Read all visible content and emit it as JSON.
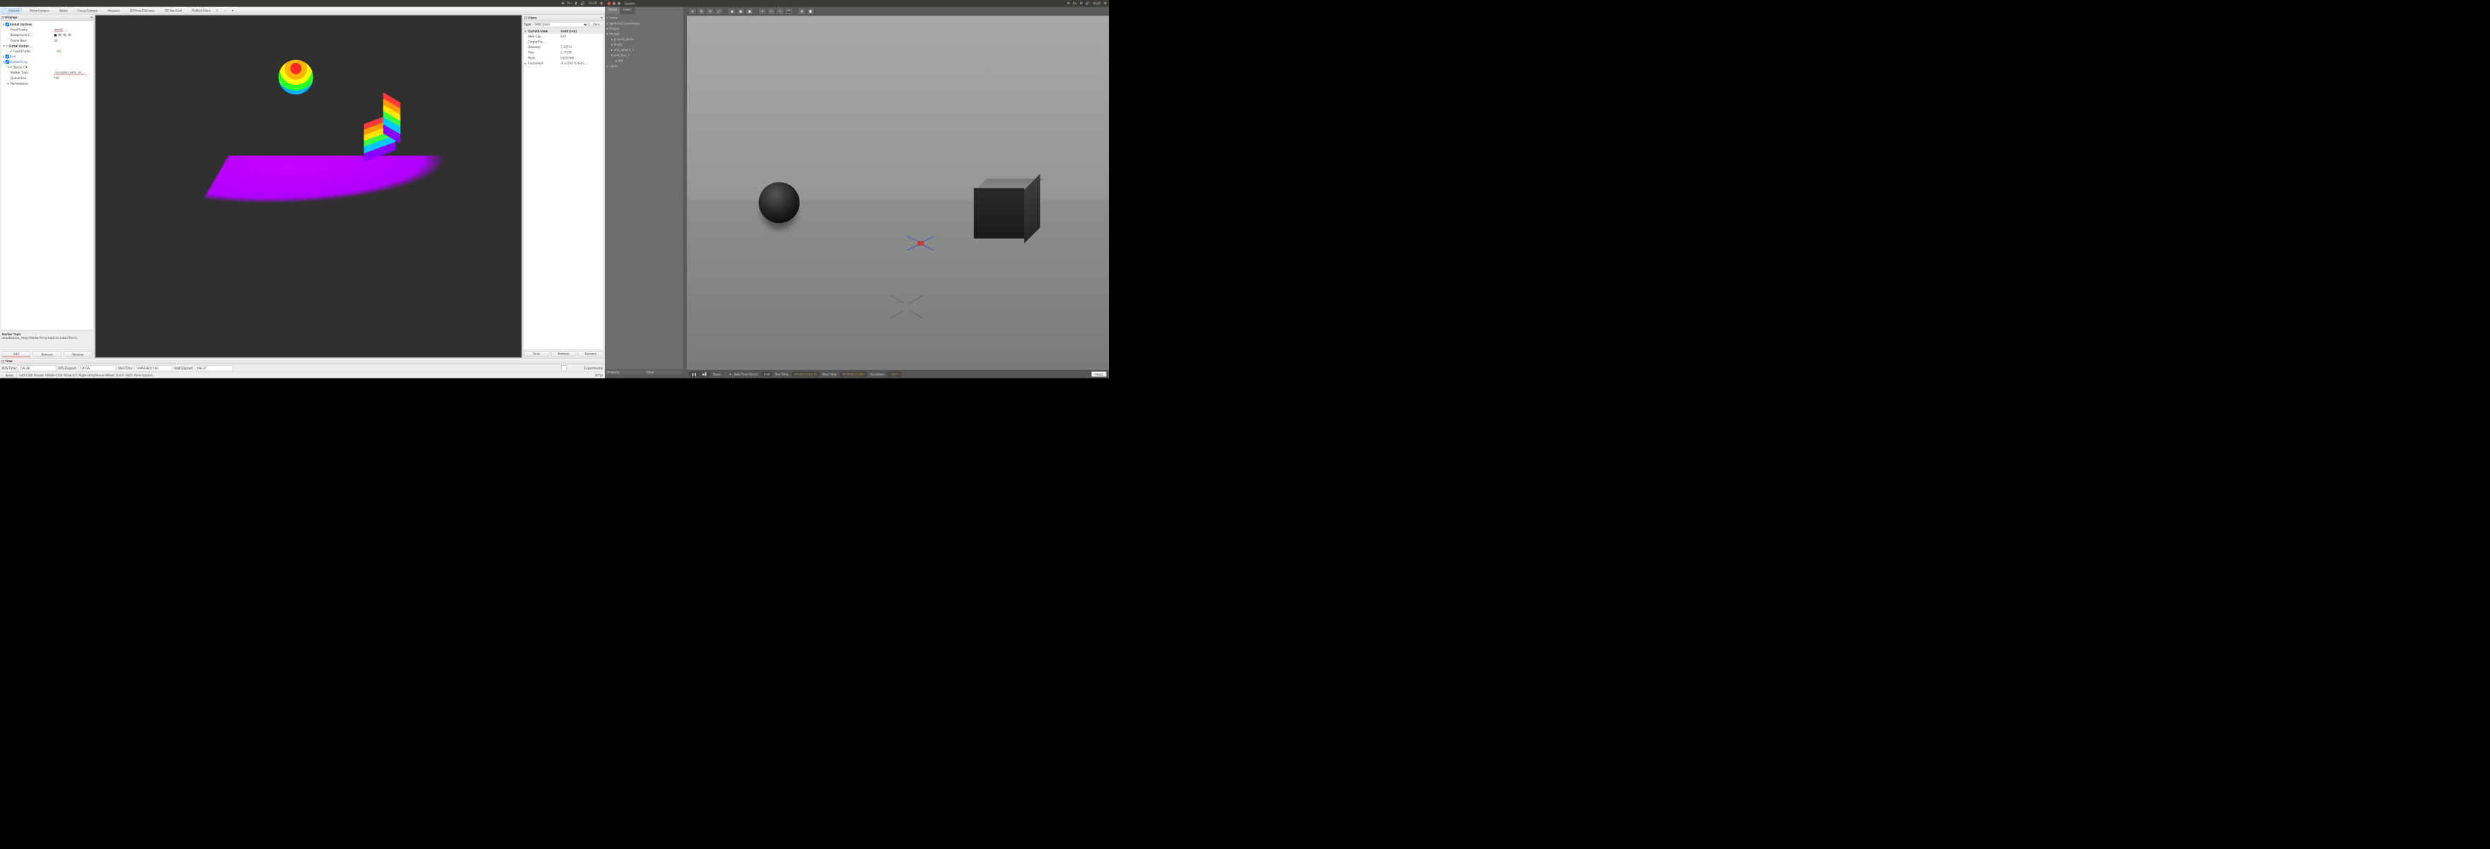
{
  "ubuntu_bar": {
    "indicators": [
      "En"
    ],
    "clock": "10:20",
    "icons": [
      "mail-icon",
      "network-icon",
      "sound-icon",
      "battery-icon",
      "gear-icon"
    ]
  },
  "rviz": {
    "toolbar": [
      {
        "id": "interact",
        "label": "Interact",
        "icon": "hand-icon",
        "active": true
      },
      {
        "id": "move-camera",
        "label": "Move Camera",
        "icon": "move-icon"
      },
      {
        "id": "select",
        "label": "Select",
        "icon": "select-icon"
      },
      {
        "id": "focus-camera",
        "label": "Focus Camera",
        "icon": "target-icon"
      },
      {
        "id": "measure",
        "label": "Measure",
        "icon": "ruler-icon"
      },
      {
        "id": "2d-pose",
        "label": "2D Pose Estimate",
        "icon": "arrow-icon"
      },
      {
        "id": "2d-nav",
        "label": "2D Nav Goal",
        "icon": "arrow-green-icon"
      },
      {
        "id": "publish-point",
        "label": "Publish Point",
        "icon": "pin-icon"
      }
    ],
    "displays_panel": {
      "title": "Displays",
      "tree": [
        {
          "d": 0,
          "tw": "▾",
          "cb": true,
          "lbl": "Global Options",
          "cls": "bold"
        },
        {
          "d": 1,
          "lbl": "Fixed Frame",
          "val": "world",
          "hl": true
        },
        {
          "d": 1,
          "lbl": "Background C…",
          "val": "■ 48; 48; 48"
        },
        {
          "d": 1,
          "lbl": "Frame Rate",
          "val": "30"
        },
        {
          "d": 0,
          "tw": "▾",
          "chk": "✔",
          "lbl": "Global Status:…",
          "cls": "bold"
        },
        {
          "d": 1,
          "chk": "✔",
          "lbl": "Fixed Frame",
          "val": "OK",
          "ok": true
        },
        {
          "d": 0,
          "tw": "▸",
          "cb": true,
          "lbl": "Grid",
          "lnk": true,
          "icon": "grid-icon"
        },
        {
          "d": 0,
          "tw": "▾",
          "cb": true,
          "lbl": "MarkerArray",
          "lnk": true,
          "icon": "marker-icon"
        },
        {
          "d": 1,
          "tw": "▾",
          "chk": "✔",
          "lbl": "Status: Ok",
          "ok": true
        },
        {
          "d": 1,
          "lbl": "Marker Topic",
          "val": "/occupied_cells_vis_…",
          "hl": true
        },
        {
          "d": 1,
          "lbl": "Queue Size",
          "val": "100"
        },
        {
          "d": 1,
          "tw": "▸",
          "lbl": "Namespaces"
        }
      ],
      "description": {
        "title": "Marker Topic",
        "body": "visualization_msgs::MarkerArray topic to subscribe to."
      },
      "buttons": {
        "add": "Add",
        "remove": "Remove",
        "rename": "Rename"
      }
    },
    "views_panel": {
      "title": "Views",
      "type_label": "Type:",
      "type_value": "Orbit (rviz)",
      "zero": "Zero",
      "rows": [
        {
          "head": true,
          "k": "Current View",
          "v": "Orbit (rviz)",
          "tw": "▾"
        },
        {
          "k": "Near Clip …",
          "v": "0.01"
        },
        {
          "k": "Target Fra…",
          "v": "<Fixed Frame>"
        },
        {
          "k": "Distance",
          "v": "7.30724"
        },
        {
          "k": "Yaw",
          "v": "3.11039"
        },
        {
          "k": "Pitch",
          "v": "0.835398"
        },
        {
          "k": "Focal Point",
          "v": "-0.33742; 0.4605…",
          "tw": "▸"
        }
      ],
      "buttons": {
        "save": "Save",
        "remove": "Remove",
        "rename": "Rename"
      }
    },
    "time_panel": {
      "title": "Time",
      "fields": {
        "ros_time_lbl": "ROS Time:",
        "ros_time": "126.38",
        "ros_elapsed_lbl": "ROS Elapsed:",
        "ros_elapsed": "120.56",
        "wall_time_lbl": "Wall Time:",
        "wall_time": "1446456017.83",
        "wall_elapsed_lbl": "Wall Elapsed:",
        "wall_elapsed": "186.37"
      },
      "experimental": "Experimental"
    },
    "status": {
      "reset": "Reset",
      "hint": "Left-Click: Rotate.  Middle-Click: Move X/Y.  Right-Click/Mouse Wheel: Zoom.  Shift: More options.",
      "fps": "30 fps"
    }
  },
  "gazebo": {
    "title": "Gazebo",
    "tabs": {
      "world": "World",
      "insert": "Insert"
    },
    "tree": [
      {
        "d": 0,
        "lbl": "Scene"
      },
      {
        "d": 0,
        "lbl": "Spherical Coordinates"
      },
      {
        "d": 0,
        "lbl": "Physics"
      },
      {
        "d": 0,
        "tw": "▾",
        "lbl": "Models"
      },
      {
        "d": 1,
        "lbl": "ground_plane"
      },
      {
        "d": 1,
        "lbl": "firefly"
      },
      {
        "d": 1,
        "lbl": "unit_sphere_1"
      },
      {
        "d": 1,
        "tw": "▾",
        "lbl": "unit_box_1"
      },
      {
        "d": 2,
        "lbl": "link"
      },
      {
        "d": 0,
        "lbl": "Lights"
      }
    ],
    "prop_head": {
      "p": "Property",
      "v": "Value"
    },
    "toolbar_icons": [
      "pointer-icon",
      "translate-icon",
      "rotate-icon",
      "scale-icon",
      "box-icon",
      "sphere-icon",
      "cylinder-icon",
      "light-point-icon",
      "light-spot-icon",
      "light-dir-icon",
      "camera-icon",
      "copy-icon",
      "paste-icon"
    ],
    "status": {
      "pause_icon": "❚❚",
      "step_icon": "▶▌",
      "steps_lbl": "Steps:",
      "steps": "1",
      "rtf_lbl": "Real Time Factor:",
      "rtf": "0.88",
      "sim_lbl": "Sim Time:",
      "sim": "00 00:02:06.210",
      "real_lbl": "Real Time:",
      "real": "00 00:02:25.491",
      "iter_lbl": "Iterations:",
      "iter": "12621",
      "reset": "Reset"
    }
  }
}
